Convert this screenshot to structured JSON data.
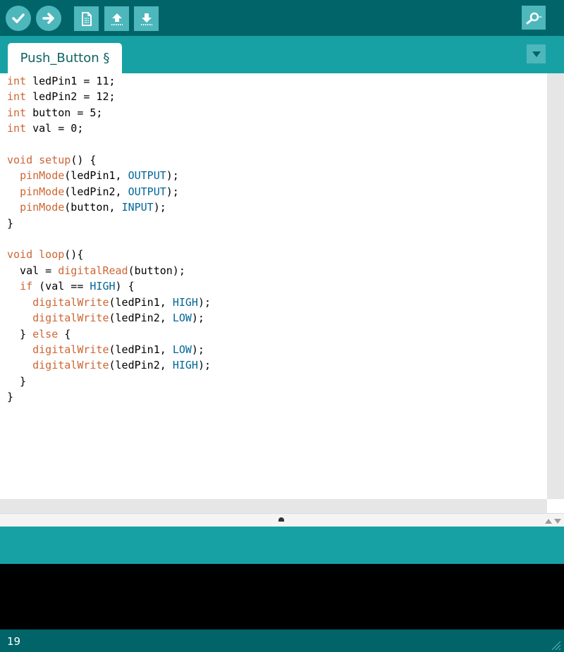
{
  "toolbar": {
    "buttons": [
      {
        "name": "verify",
        "icon": "checkmark-icon"
      },
      {
        "name": "upload",
        "icon": "arrow-right-icon"
      },
      {
        "name": "new",
        "icon": "new-document-icon"
      },
      {
        "name": "open",
        "icon": "arrow-up-icon"
      },
      {
        "name": "save",
        "icon": "arrow-down-icon"
      },
      {
        "name": "serial-monitor",
        "icon": "magnifier-icon"
      }
    ]
  },
  "tabs": [
    {
      "label": "Push_Button §",
      "active": true
    }
  ],
  "editor": {
    "lines": [
      "int ledPin1 = 11;",
      "int ledPin2 = 12;",
      "int button = 5;",
      "int val = 0;",
      "",
      "void setup() {",
      "  pinMode(ledPin1, OUTPUT);",
      "  pinMode(ledPin2, OUTPUT);",
      "  pinMode(button, INPUT);",
      "}",
      "",
      "void loop(){",
      "  val = digitalRead(button);",
      "  if (val == HIGH) {",
      "    digitalWrite(ledPin1, HIGH);",
      "    digitalWrite(ledPin2, LOW);",
      "  } else {",
      "    digitalWrite(ledPin1, LOW);",
      "    digitalWrite(ledPin2, HIGH);",
      "  }",
      "}"
    ],
    "syntax_colors": {
      "keyword": "#cc6633",
      "function": "#cc6633",
      "constant": "#006699",
      "text": "#000000"
    }
  },
  "status": {
    "line_number": "19"
  },
  "colors": {
    "toolbar_bg": "#006468",
    "tabbar_bg": "#17a1a5",
    "button_bg": "#4db7bb",
    "console_bg": "#000000"
  }
}
